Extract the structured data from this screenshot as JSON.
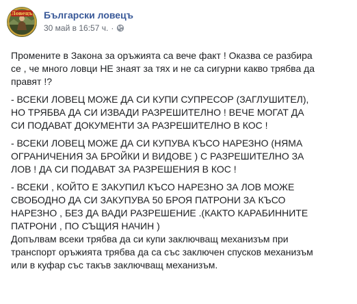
{
  "post": {
    "page_name": "Български ловецъ",
    "timestamp": "30 май в 16:57 ч.",
    "separator": "·",
    "privacy_icon": "globe-icon",
    "avatar_icon": "page-avatar-logo",
    "avatar_logo_text": "Ловецъ",
    "paragraphs": [
      "Промените в Закона за оръжията са вече факт ! Оказва се разбира\nсе , че много ловци НЕ знаят за тях и не са сигурни какво трябва да\nправят !?",
      "- ВСЕКИ ЛОВЕЦ МОЖЕ ДА СИ КУПИ СУПРЕСОР (ЗАГЛУШИТЕЛ),\nНО ТРЯБВА ДА СИ ИЗВАДИ РАЗРЕШИТЕЛНО ! ВЕЧЕ МОГАТ ДА\nСИ ПОДАВАТ ДОКУМЕНТИ ЗА РАЗРЕШИТЕЛНО В КОС !",
      "- ВСЕКИ ЛОВЕЦ МОЖЕ ДА СИ КУПУВА КЪСО НАРЕЗНО (НЯМА\nОГРАНИЧЕНИЯ ЗА БРОЙКИ И ВИДОВЕ ) С РАЗРЕШИТЕЛНО ЗА\nЛОВ ! ДА СИ ПОДАВАТ ЗА РАЗРЕШЕНИЯ В КОС !",
      "- ВСЕКИ , КОЙТО Е ЗАКУПИЛ КЪСО НАРЕЗНО ЗА ЛОВ МОЖЕ\nСВОБОДНО ДА СИ ЗАКУПУВА 50 БРОЯ ПАТРОНИ ЗА КЪСО\nНАРЕЗНО , БЕЗ ДА ВАДИ РАЗРЕШЕНИЕ .(КАКТО КАРАБИННИТЕ\nПАТРОНИ , ПО СЪЩИЯ НАЧИН )",
      "Допълвам всеки трябва да си купи заключващ механизъм при\nтранспорт оръжията трябва да са със заключен спусков механизъм\nили в куфар със такъв заключващ механизъм."
    ]
  },
  "colors": {
    "page_name": "#385898",
    "meta_text": "#616770",
    "body_text": "#1c1e21",
    "background": "#ffffff"
  }
}
